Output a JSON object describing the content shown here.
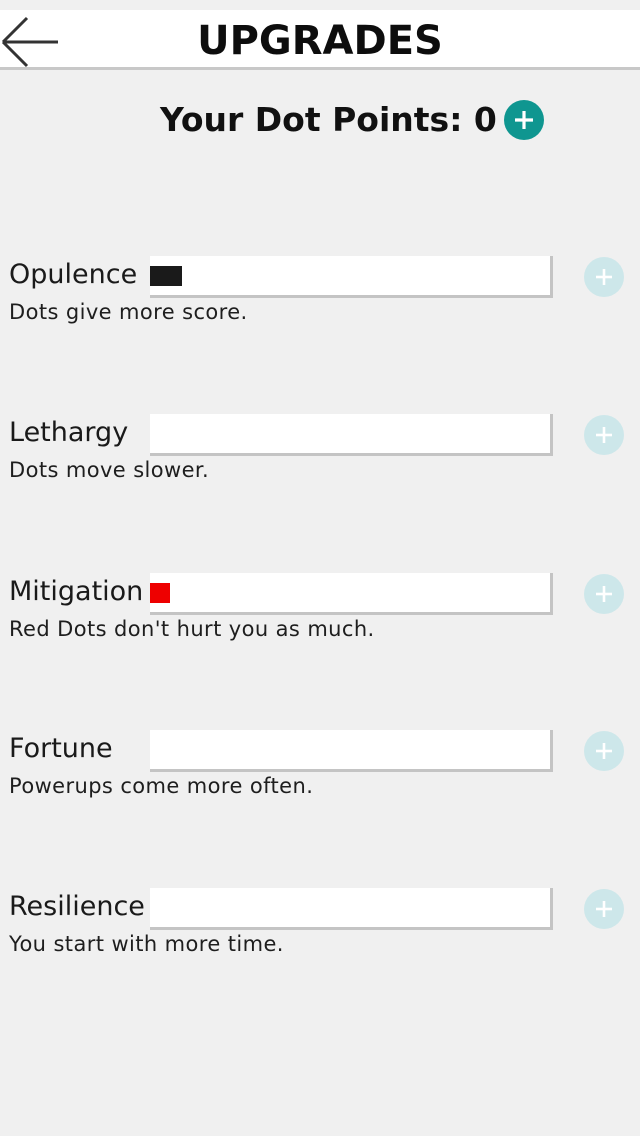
{
  "header": {
    "title": "UPGRADES",
    "back_icon": "arrow-left-icon"
  },
  "points": {
    "label": "Your Dot Points: 0",
    "add_icon": "plus-icon",
    "accent_color": "#0f9690"
  },
  "upgrades": [
    {
      "name": "Opulence",
      "description": "Dots give more score.",
      "level_color": "#1a1a1a",
      "level_fraction": 0.08,
      "button_icon": "plus-icon",
      "button_enabled": false
    },
    {
      "name": "Lethargy",
      "description": "Dots move slower.",
      "level_color": "#1a1a1a",
      "level_fraction": 0.0,
      "button_icon": "plus-icon",
      "button_enabled": false
    },
    {
      "name": "Mitigation",
      "description": "Red Dots don't hurt you as much.",
      "level_color": "#ee0000",
      "level_fraction": 0.05,
      "button_icon": "plus-icon",
      "button_enabled": false
    },
    {
      "name": "Fortune",
      "description": "Powerups come more often.",
      "level_color": "#1a1a1a",
      "level_fraction": 0.0,
      "button_icon": "plus-icon",
      "button_enabled": false
    },
    {
      "name": "Resilience",
      "description": "You start with more time.",
      "level_color": "#1a1a1a",
      "level_fraction": 0.0,
      "button_icon": "plus-icon",
      "button_enabled": false
    }
  ]
}
